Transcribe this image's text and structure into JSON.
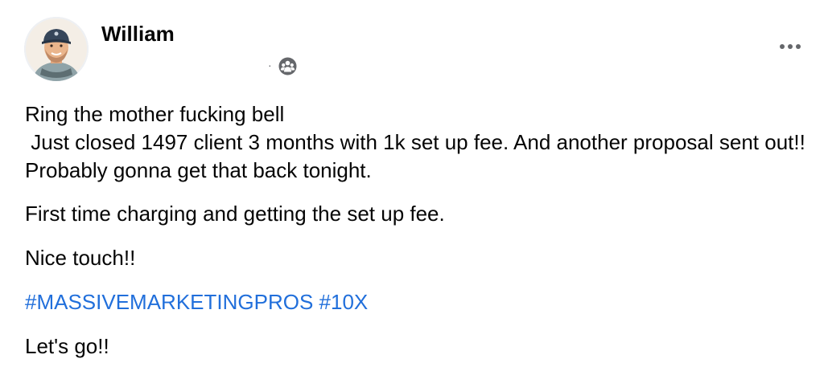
{
  "post": {
    "author": "William",
    "meta_separator": "·",
    "audience_icon": "group-icon",
    "more_icon": "ellipsis-icon",
    "lines": [
      "Ring the mother fucking bell",
      " Just closed 1497 client 3 months with 1k set up fee. And another proposal sent out!! Probably gonna get that back tonight.",
      "First time charging and getting the set up fee.",
      "Nice touch!!",
      "Let's go!!"
    ],
    "hashtags": [
      "#MASSIVEMARKETINGPROS",
      "#10X"
    ]
  },
  "colors": {
    "text": "#050505",
    "secondary": "#65676b",
    "link": "#216fdb"
  }
}
